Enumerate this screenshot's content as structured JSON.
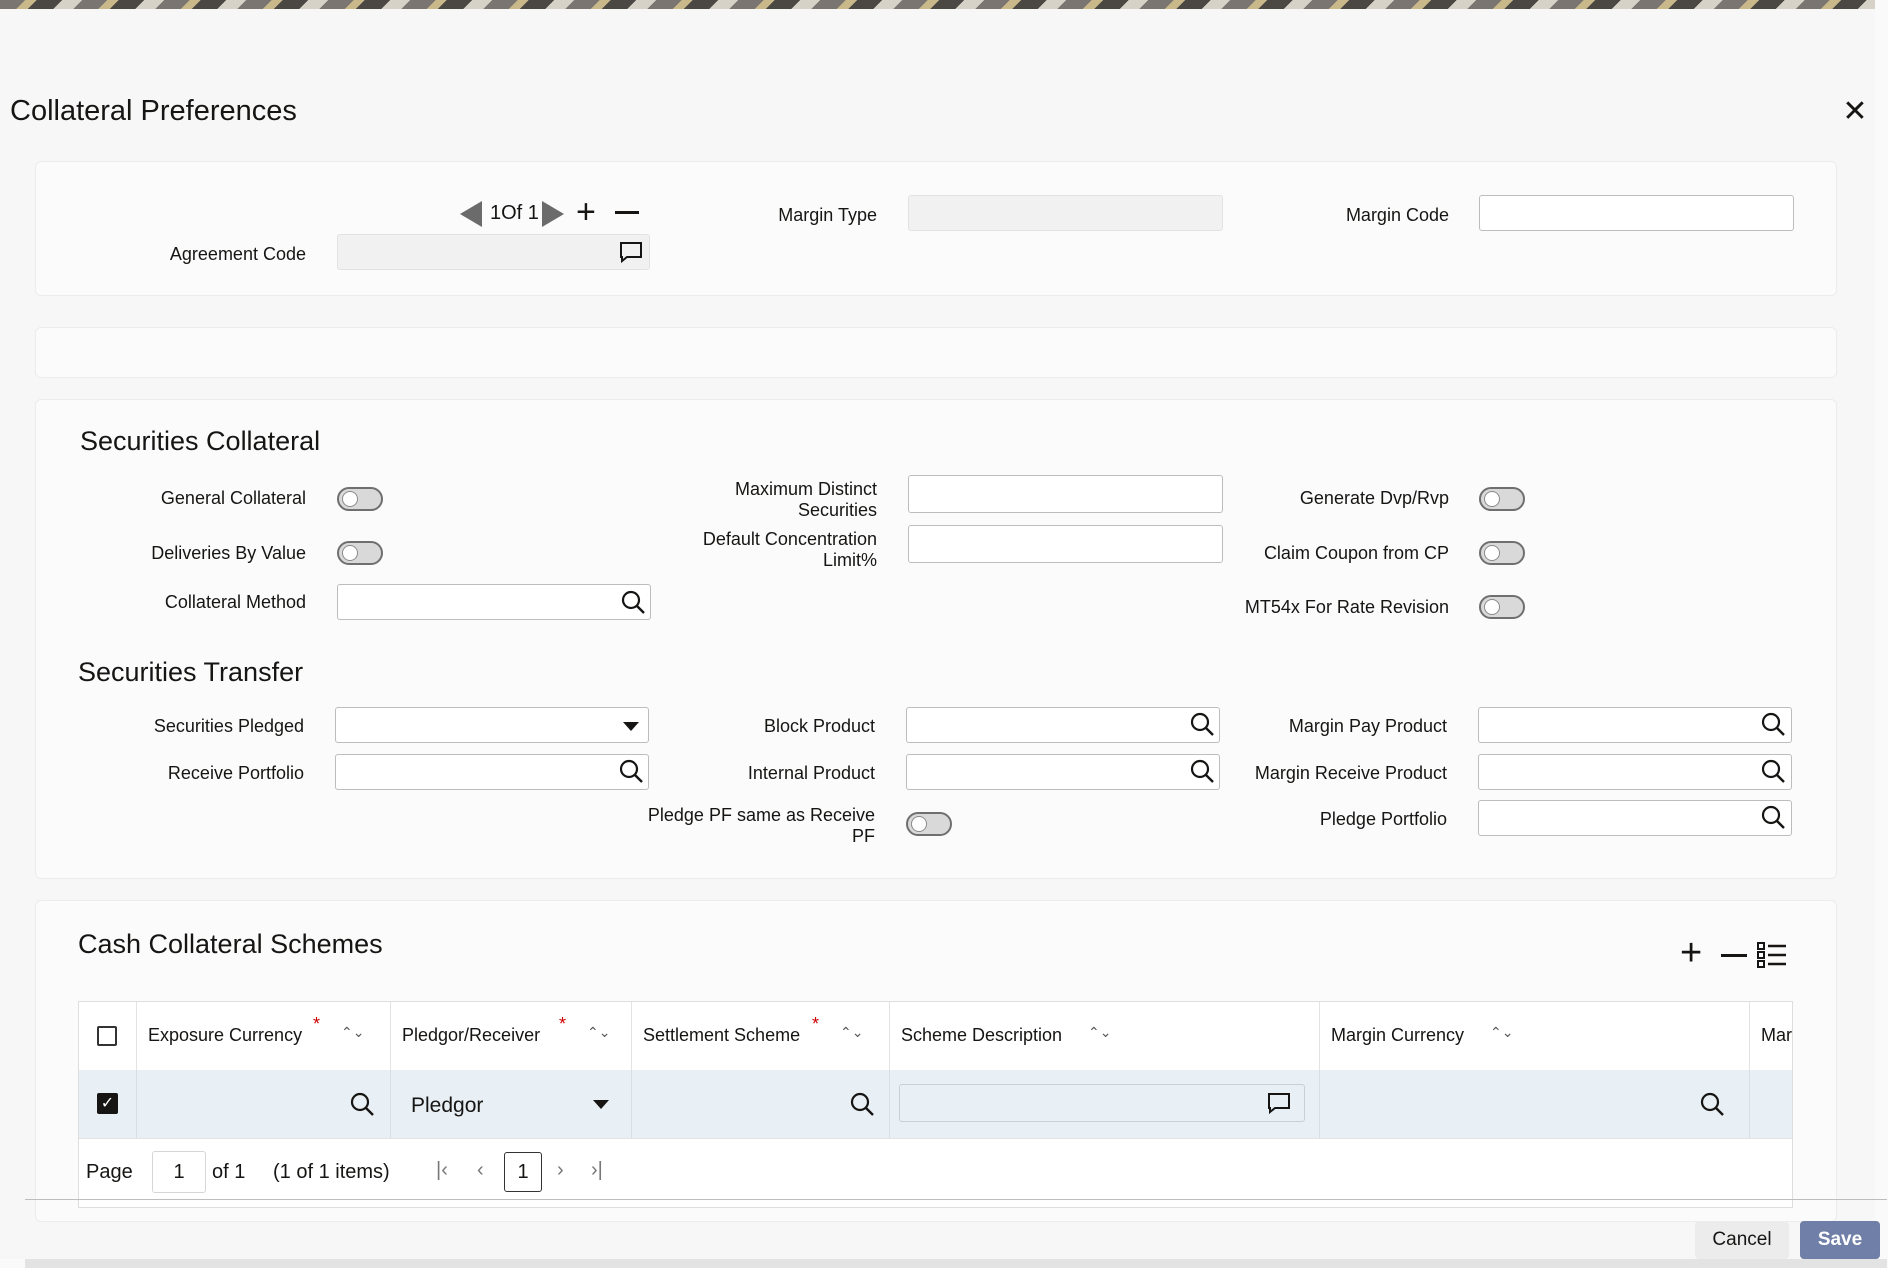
{
  "dialog": {
    "title": "Collateral Preferences"
  },
  "header": {
    "record_nav": "1Of 1",
    "agreement_code_label": "Agreement Code",
    "margin_type_label": "Margin Type",
    "margin_code_label": "Margin Code"
  },
  "securities_collateral": {
    "title": "Securities Collateral",
    "general_collateral": "General Collateral",
    "deliveries_by_value": "Deliveries By Value",
    "collateral_method": "Collateral Method",
    "max_distinct_securities_line1": "Maximum Distinct",
    "max_distinct_securities_line2": "Securities",
    "default_concentration_line1": "Default Concentration",
    "default_concentration_line2": "Limit%",
    "generate_dvp_rvp": "Generate Dvp/Rvp",
    "claim_coupon": "Claim Coupon from CP",
    "mt54x": "MT54x For Rate Revision"
  },
  "securities_transfer": {
    "title": "Securities Transfer",
    "securities_pledged": "Securities Pledged",
    "receive_portfolio": "Receive Portfolio",
    "block_product": "Block Product",
    "internal_product": "Internal Product",
    "pledge_pf_line1": "Pledge PF same as Receive",
    "pledge_pf_line2": "PF",
    "margin_pay_product": "Margin Pay Product",
    "margin_receive_product": "Margin Receive Product",
    "pledge_portfolio": "Pledge Portfolio"
  },
  "cash_collateral": {
    "title": "Cash Collateral Schemes",
    "columns": [
      "Exposure Currency",
      "Pledgor/Receiver",
      "Settlement Scheme",
      "Scheme Description",
      "Margin Currency",
      "Mar"
    ],
    "row": {
      "pledgor_receiver": "Pledgor"
    },
    "pager": {
      "page_label": "Page",
      "page_value": "1",
      "of_label": "of 1",
      "items_label": "(1 of 1 items)",
      "current": "1"
    }
  },
  "footer": {
    "cancel": "Cancel",
    "save": "Save"
  },
  "colors": {
    "accent": "#6f7fa8",
    "row_selected": "#e8eff5",
    "required": "#cc0000"
  }
}
